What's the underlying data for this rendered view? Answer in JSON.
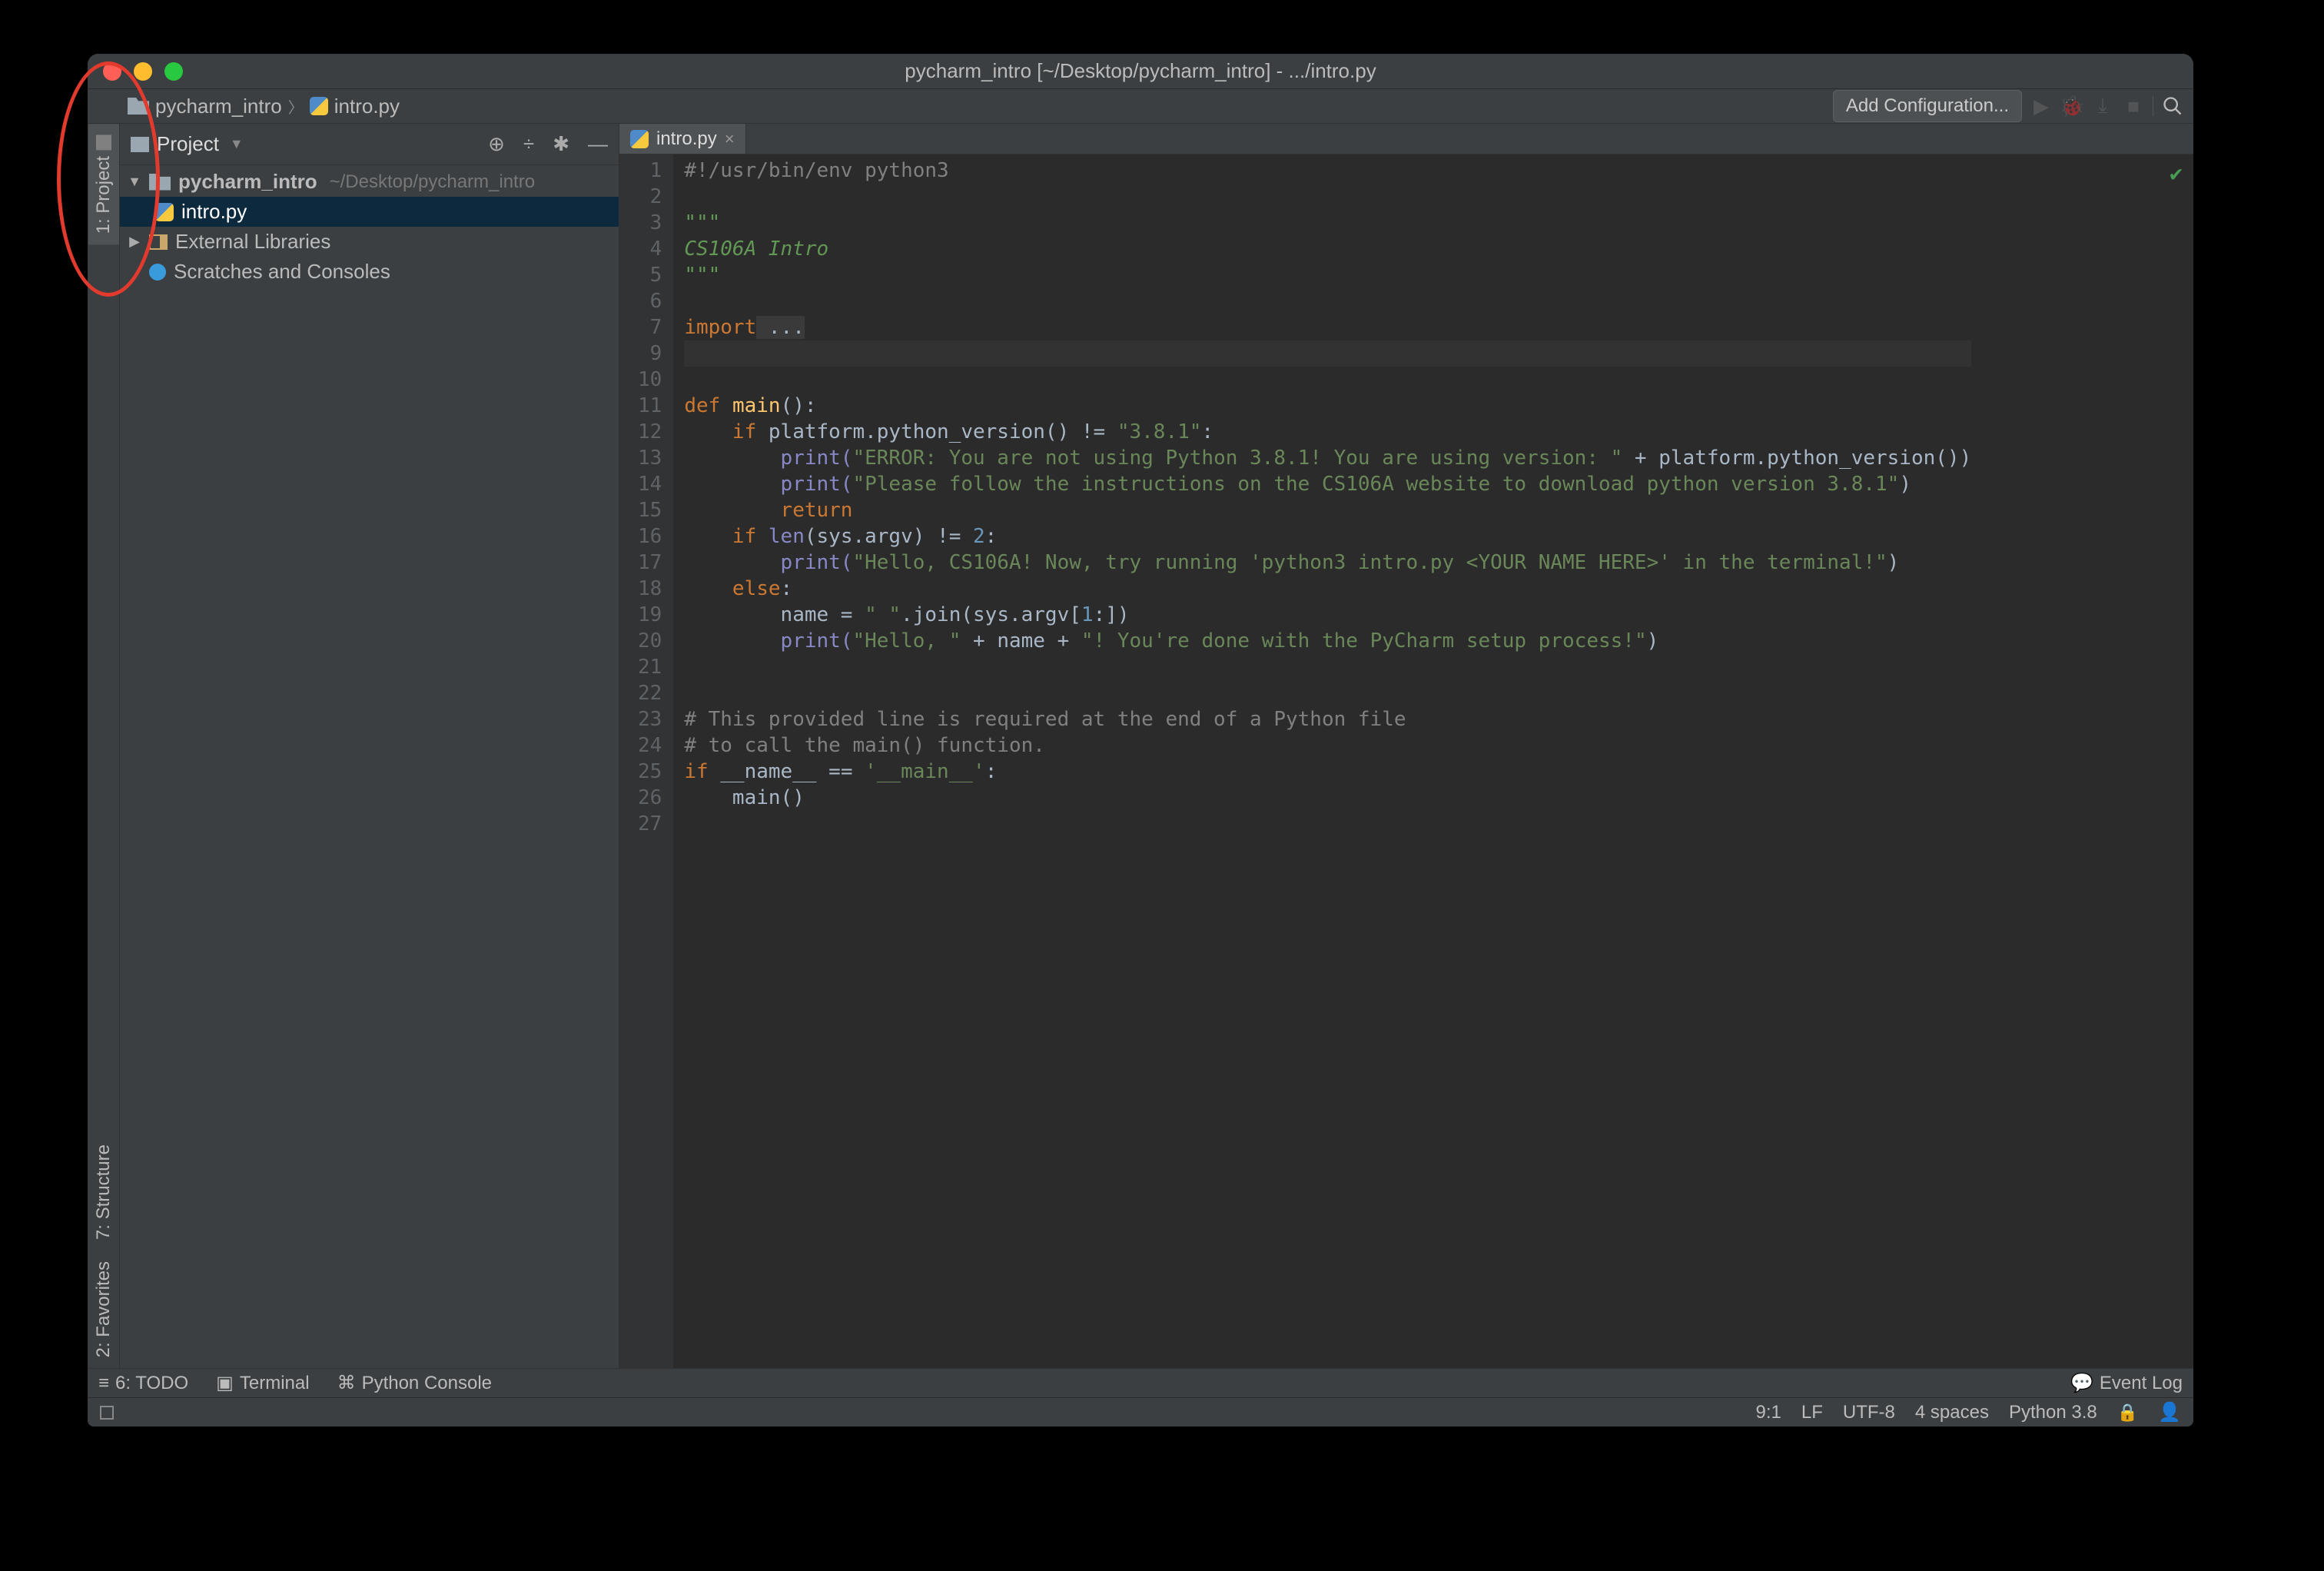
{
  "window": {
    "title": "pycharm_intro [~/Desktop/pycharm_intro] - .../intro.py"
  },
  "breadcrumbs": {
    "root": "pycharm_intro",
    "file": "intro.py"
  },
  "toolbar": {
    "add_config": "Add Configuration..."
  },
  "project_panel": {
    "title": "Project",
    "root": "pycharm_intro",
    "root_path": "~/Desktop/pycharm_intro",
    "file": "intro.py",
    "ext_lib": "External Libraries",
    "scratches": "Scratches and Consoles"
  },
  "left_tabs": {
    "project": "1: Project",
    "structure": "7: Structure",
    "favorites": "2: Favorites"
  },
  "editor_tab": {
    "name": "intro.py"
  },
  "code": {
    "l1": "#!/usr/bin/env python3",
    "l2": "",
    "l3": "\"\"\"",
    "l4": "CS106A Intro",
    "l5": "\"\"\"",
    "l6": "",
    "l7_a": "import",
    "l7_b": " ...",
    "l9": "",
    "l10": "",
    "l11_def": "def ",
    "l11_name": "main",
    "l11_rest": "():",
    "l12_if": "    if ",
    "l12_cond": "platform.python_version() != ",
    "l12_str": "\"3.8.1\"",
    "l12_colon": ":",
    "l13_print": "        print(",
    "l13_str": "\"ERROR: You are not using Python 3.8.1! You are using version: \"",
    "l13_plus": " + platform.python_version())",
    "l14_print": "        print(",
    "l14_str": "\"Please follow the instructions on the CS106A website to download python version 3.8.1\"",
    "l14_close": ")",
    "l15": "        return",
    "l16_if": "    if ",
    "l16_len": "len",
    "l16_mid": "(sys.argv) != ",
    "l16_num": "2",
    "l16_colon": ":",
    "l17_print": "        print(",
    "l17_str": "\"Hello, CS106A! Now, try running 'python3 intro.py <YOUR NAME HERE>' in the terminal!\"",
    "l17_close": ")",
    "l18_else": "    else",
    "l18_colon": ":",
    "l19_a": "        name = ",
    "l19_str": "\" \"",
    "l19_b": ".join(sys.argv[",
    "l19_num": "1",
    "l19_c": ":])",
    "l20_print": "        print(",
    "l20_s1": "\"Hello, \"",
    "l20_a": " + name + ",
    "l20_s2": "\"! You're done with the PyCharm setup process!\"",
    "l20_close": ")",
    "l23": "# This provided line is required at the end of a Python file",
    "l24": "# to call the main() function.",
    "l25_if": "if ",
    "l25_name": "__name__ ",
    "l25_eq": "== ",
    "l25_str": "'__main__'",
    "l25_colon": ":",
    "l26": "    main()"
  },
  "line_numbers": [
    "1",
    "2",
    "3",
    "4",
    "5",
    "6",
    "7",
    "9",
    "10",
    "11",
    "12",
    "13",
    "14",
    "15",
    "16",
    "17",
    "18",
    "19",
    "20",
    "21",
    "22",
    "23",
    "24",
    "25",
    "26",
    "27"
  ],
  "bottom": {
    "todo": "6: TODO",
    "terminal": "Terminal",
    "pyconsole": "Python Console",
    "eventlog": "Event Log"
  },
  "status": {
    "pos": "9:1",
    "lf": "LF",
    "enc": "UTF-8",
    "indent": "4 spaces",
    "interp": "Python 3.8"
  }
}
